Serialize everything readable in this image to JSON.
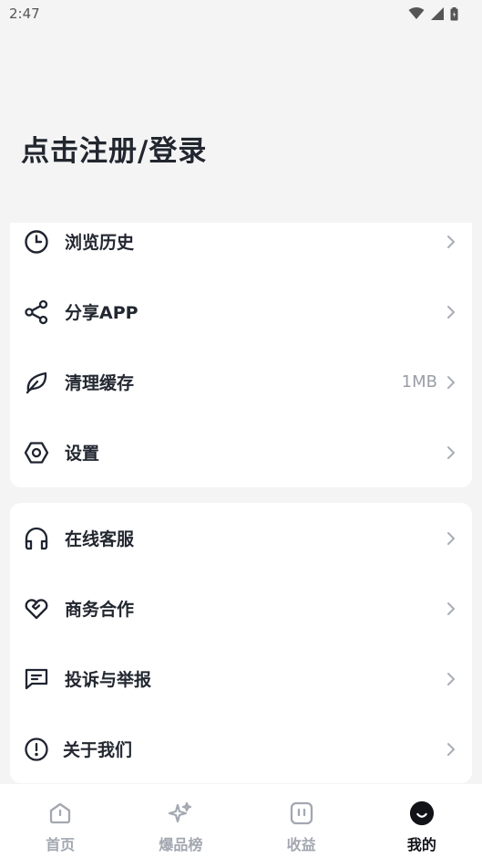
{
  "status_bar": {
    "time": "2:47"
  },
  "header": {
    "login_title": "点击注册/登录"
  },
  "menu_group_1": [
    {
      "label": "浏览历史",
      "icon": "clock-icon",
      "value": ""
    },
    {
      "label": "分享APP",
      "icon": "share-icon",
      "value": ""
    },
    {
      "label": "清理缓存",
      "icon": "leaf-icon",
      "value": "1MB"
    },
    {
      "label": "设置",
      "icon": "hexagon-settings-icon",
      "value": ""
    }
  ],
  "menu_group_2": [
    {
      "label": "在线客服",
      "icon": "headphones-icon"
    },
    {
      "label": "商务合作",
      "icon": "heart-handshake-icon"
    },
    {
      "label": "投诉与举报",
      "icon": "message-square-icon"
    },
    {
      "label": "关于我们",
      "icon": "alert-circle-icon"
    }
  ],
  "tab_bar": {
    "tabs": [
      {
        "label": "首页",
        "icon": "home-icon"
      },
      {
        "label": "爆品榜",
        "icon": "sparkle-icon"
      },
      {
        "label": "收益",
        "icon": "earnings-icon"
      },
      {
        "label": "我的",
        "icon": "profile-icon"
      }
    ],
    "active_index": 3
  },
  "colors": {
    "background": "#f4f4f5",
    "card": "#ffffff",
    "text": "#222730",
    "muted": "#9a9ea6",
    "tab_inactive": "#a3a7b0"
  }
}
